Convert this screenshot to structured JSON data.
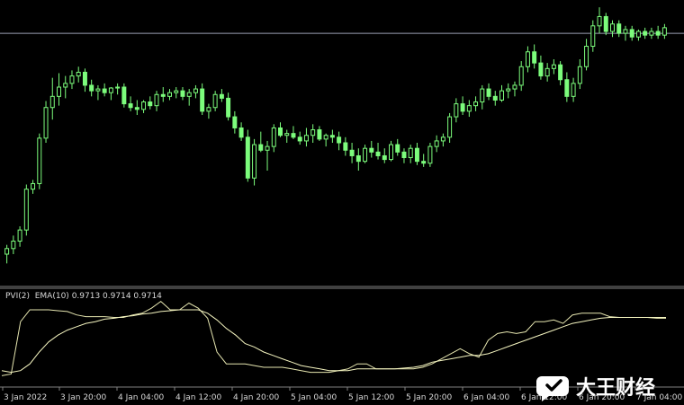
{
  "indicator": {
    "name": "PVI(2)",
    "ema_label": "EMA(10)",
    "values_text": "0.9713 0.9714 0.9714"
  },
  "colors": {
    "background": "#000000",
    "candle": "#7CFC7C",
    "pvi_line": "#E6E6B0",
    "ema_line": "#F5F5C0",
    "separator": "#808080",
    "level_line": "#9aa0b4",
    "axis_text": "#d8d8d8"
  },
  "watermark": {
    "text": "大王财经",
    "icon": "chat-bubble-logo-icon"
  },
  "chart_data": [
    {
      "type": "candlestick",
      "grid": false,
      "title": "",
      "x_tick_labels": [
        "3 Jan 2022",
        "3 Jan 20:00",
        "4 Jan 04:00",
        "4 Jan 12:00",
        "4 Jan 20:00",
        "5 Jan 04:00",
        "5 Jan 12:00",
        "5 Jan 20:00",
        "6 Jan 04:00",
        "6 Jan 12:00",
        "6 Jan 20:00",
        "7 Jan 04:00"
      ],
      "ylim": [
        0,
        300
      ],
      "horizontal_level": 268,
      "candles": [
        {
          "o": 30,
          "h": 40,
          "l": 20,
          "c": 36
        },
        {
          "o": 36,
          "h": 50,
          "l": 30,
          "c": 44
        },
        {
          "o": 44,
          "h": 60,
          "l": 38,
          "c": 56
        },
        {
          "o": 56,
          "h": 105,
          "l": 50,
          "c": 100
        },
        {
          "o": 100,
          "h": 110,
          "l": 95,
          "c": 106
        },
        {
          "o": 106,
          "h": 160,
          "l": 100,
          "c": 155
        },
        {
          "o": 155,
          "h": 195,
          "l": 150,
          "c": 188
        },
        {
          "o": 188,
          "h": 220,
          "l": 175,
          "c": 200
        },
        {
          "o": 200,
          "h": 225,
          "l": 190,
          "c": 210
        },
        {
          "o": 210,
          "h": 222,
          "l": 198,
          "c": 214
        },
        {
          "o": 214,
          "h": 228,
          "l": 208,
          "c": 222
        },
        {
          "o": 222,
          "h": 232,
          "l": 215,
          "c": 226
        },
        {
          "o": 226,
          "h": 230,
          "l": 205,
          "c": 212
        },
        {
          "o": 212,
          "h": 218,
          "l": 200,
          "c": 206
        },
        {
          "o": 206,
          "h": 212,
          "l": 196,
          "c": 208
        },
        {
          "o": 208,
          "h": 214,
          "l": 200,
          "c": 204
        },
        {
          "o": 204,
          "h": 210,
          "l": 196,
          "c": 209
        },
        {
          "o": 209,
          "h": 214,
          "l": 202,
          "c": 210
        },
        {
          "o": 210,
          "h": 214,
          "l": 188,
          "c": 192
        },
        {
          "o": 192,
          "h": 200,
          "l": 184,
          "c": 188
        },
        {
          "o": 188,
          "h": 196,
          "l": 180,
          "c": 186
        },
        {
          "o": 186,
          "h": 196,
          "l": 182,
          "c": 194
        },
        {
          "o": 194,
          "h": 200,
          "l": 186,
          "c": 190
        },
        {
          "o": 190,
          "h": 206,
          "l": 184,
          "c": 202
        },
        {
          "o": 202,
          "h": 210,
          "l": 194,
          "c": 200
        },
        {
          "o": 200,
          "h": 208,
          "l": 196,
          "c": 204
        },
        {
          "o": 204,
          "h": 210,
          "l": 198,
          "c": 206
        },
        {
          "o": 206,
          "h": 210,
          "l": 196,
          "c": 200
        },
        {
          "o": 200,
          "h": 208,
          "l": 190,
          "c": 204
        },
        {
          "o": 204,
          "h": 212,
          "l": 198,
          "c": 208
        },
        {
          "o": 208,
          "h": 214,
          "l": 180,
          "c": 184
        },
        {
          "o": 184,
          "h": 192,
          "l": 176,
          "c": 188
        },
        {
          "o": 188,
          "h": 206,
          "l": 184,
          "c": 202
        },
        {
          "o": 202,
          "h": 208,
          "l": 194,
          "c": 198
        },
        {
          "o": 198,
          "h": 204,
          "l": 174,
          "c": 178
        },
        {
          "o": 178,
          "h": 184,
          "l": 160,
          "c": 166
        },
        {
          "o": 166,
          "h": 172,
          "l": 152,
          "c": 156
        },
        {
          "o": 156,
          "h": 164,
          "l": 108,
          "c": 112
        },
        {
          "o": 112,
          "h": 154,
          "l": 104,
          "c": 148
        },
        {
          "o": 148,
          "h": 162,
          "l": 140,
          "c": 142
        },
        {
          "o": 142,
          "h": 152,
          "l": 120,
          "c": 146
        },
        {
          "o": 146,
          "h": 170,
          "l": 140,
          "c": 166
        },
        {
          "o": 166,
          "h": 172,
          "l": 156,
          "c": 158
        },
        {
          "o": 158,
          "h": 164,
          "l": 150,
          "c": 160
        },
        {
          "o": 160,
          "h": 168,
          "l": 154,
          "c": 156
        },
        {
          "o": 156,
          "h": 162,
          "l": 148,
          "c": 152
        },
        {
          "o": 152,
          "h": 166,
          "l": 146,
          "c": 158
        },
        {
          "o": 158,
          "h": 170,
          "l": 150,
          "c": 164
        },
        {
          "o": 164,
          "h": 168,
          "l": 152,
          "c": 154
        },
        {
          "o": 154,
          "h": 160,
          "l": 146,
          "c": 158
        },
        {
          "o": 158,
          "h": 164,
          "l": 150,
          "c": 156
        },
        {
          "o": 156,
          "h": 162,
          "l": 142,
          "c": 150
        },
        {
          "o": 150,
          "h": 156,
          "l": 136,
          "c": 142
        },
        {
          "o": 142,
          "h": 150,
          "l": 128,
          "c": 136
        },
        {
          "o": 136,
          "h": 144,
          "l": 120,
          "c": 130
        },
        {
          "o": 130,
          "h": 148,
          "l": 128,
          "c": 144
        },
        {
          "o": 144,
          "h": 152,
          "l": 134,
          "c": 140
        },
        {
          "o": 140,
          "h": 150,
          "l": 132,
          "c": 136
        },
        {
          "o": 136,
          "h": 144,
          "l": 128,
          "c": 132
        },
        {
          "o": 132,
          "h": 152,
          "l": 130,
          "c": 148
        },
        {
          "o": 148,
          "h": 154,
          "l": 136,
          "c": 140
        },
        {
          "o": 140,
          "h": 144,
          "l": 128,
          "c": 134
        },
        {
          "o": 134,
          "h": 148,
          "l": 128,
          "c": 144
        },
        {
          "o": 144,
          "h": 150,
          "l": 126,
          "c": 130
        },
        {
          "o": 130,
          "h": 138,
          "l": 124,
          "c": 128
        },
        {
          "o": 128,
          "h": 150,
          "l": 124,
          "c": 146
        },
        {
          "o": 146,
          "h": 158,
          "l": 140,
          "c": 152
        },
        {
          "o": 152,
          "h": 160,
          "l": 146,
          "c": 156
        },
        {
          "o": 156,
          "h": 182,
          "l": 150,
          "c": 178
        },
        {
          "o": 178,
          "h": 198,
          "l": 172,
          "c": 192
        },
        {
          "o": 192,
          "h": 200,
          "l": 180,
          "c": 184
        },
        {
          "o": 184,
          "h": 196,
          "l": 178,
          "c": 190
        },
        {
          "o": 190,
          "h": 200,
          "l": 184,
          "c": 194
        },
        {
          "o": 194,
          "h": 212,
          "l": 186,
          "c": 208
        },
        {
          "o": 208,
          "h": 214,
          "l": 196,
          "c": 200
        },
        {
          "o": 200,
          "h": 206,
          "l": 190,
          "c": 196
        },
        {
          "o": 196,
          "h": 212,
          "l": 194,
          "c": 206
        },
        {
          "o": 206,
          "h": 214,
          "l": 198,
          "c": 208
        },
        {
          "o": 208,
          "h": 216,
          "l": 200,
          "c": 212
        },
        {
          "o": 212,
          "h": 238,
          "l": 206,
          "c": 232
        },
        {
          "o": 232,
          "h": 254,
          "l": 226,
          "c": 248
        },
        {
          "o": 248,
          "h": 256,
          "l": 230,
          "c": 236
        },
        {
          "o": 236,
          "h": 244,
          "l": 218,
          "c": 222
        },
        {
          "o": 222,
          "h": 236,
          "l": 216,
          "c": 230
        },
        {
          "o": 230,
          "h": 240,
          "l": 224,
          "c": 234
        },
        {
          "o": 234,
          "h": 238,
          "l": 212,
          "c": 218
        },
        {
          "o": 218,
          "h": 226,
          "l": 194,
          "c": 200
        },
        {
          "o": 200,
          "h": 220,
          "l": 194,
          "c": 214
        },
        {
          "o": 214,
          "h": 240,
          "l": 208,
          "c": 232
        },
        {
          "o": 232,
          "h": 262,
          "l": 228,
          "c": 254
        },
        {
          "o": 254,
          "h": 282,
          "l": 248,
          "c": 276
        },
        {
          "o": 276,
          "h": 296,
          "l": 268,
          "c": 286
        },
        {
          "o": 286,
          "h": 290,
          "l": 266,
          "c": 270
        },
        {
          "o": 270,
          "h": 282,
          "l": 264,
          "c": 278
        },
        {
          "o": 278,
          "h": 282,
          "l": 264,
          "c": 268
        },
        {
          "o": 268,
          "h": 276,
          "l": 260,
          "c": 272
        },
        {
          "o": 272,
          "h": 276,
          "l": 260,
          "c": 264
        },
        {
          "o": 264,
          "h": 272,
          "l": 260,
          "c": 270
        },
        {
          "o": 270,
          "h": 274,
          "l": 262,
          "c": 266
        },
        {
          "o": 266,
          "h": 274,
          "l": 262,
          "c": 270
        },
        {
          "o": 270,
          "h": 276,
          "l": 262,
          "c": 266
        },
        {
          "o": 266,
          "h": 278,
          "l": 262,
          "c": 274
        }
      ]
    },
    {
      "type": "line",
      "grid": false,
      "title": "",
      "ylim": [
        0,
        100
      ],
      "series": [
        {
          "name": "PVI(2)",
          "values": [
            6,
            8,
            70,
            84,
            84,
            84,
            83,
            82,
            78,
            76,
            76,
            76,
            75,
            75,
            78,
            80,
            86,
            94,
            84,
            84,
            92,
            86,
            74,
            34,
            20,
            20,
            20,
            18,
            16,
            16,
            16,
            14,
            12,
            10,
            10,
            10,
            12,
            14,
            20,
            20,
            14,
            14,
            14,
            14,
            14,
            16,
            20,
            26,
            32,
            38,
            32,
            28,
            48,
            56,
            58,
            56,
            58,
            70,
            70,
            72,
            68,
            78,
            80,
            80,
            80,
            76,
            75,
            75,
            75,
            75,
            74,
            74
          ]
        },
        {
          "name": "EMA(10)",
          "values": [
            12,
            10,
            12,
            20,
            34,
            46,
            54,
            60,
            64,
            68,
            70,
            73,
            74,
            76,
            77,
            79,
            80,
            82,
            83,
            84,
            84,
            84,
            80,
            72,
            62,
            54,
            44,
            40,
            34,
            30,
            26,
            22,
            18,
            16,
            14,
            12,
            12,
            12,
            14,
            14,
            14,
            14,
            14,
            15,
            16,
            18,
            22,
            24,
            26,
            28,
            30,
            30,
            32,
            36,
            40,
            44,
            48,
            52,
            56,
            60,
            64,
            68,
            70,
            72,
            74,
            75,
            75,
            75,
            75,
            75,
            75,
            75
          ]
        }
      ]
    }
  ]
}
